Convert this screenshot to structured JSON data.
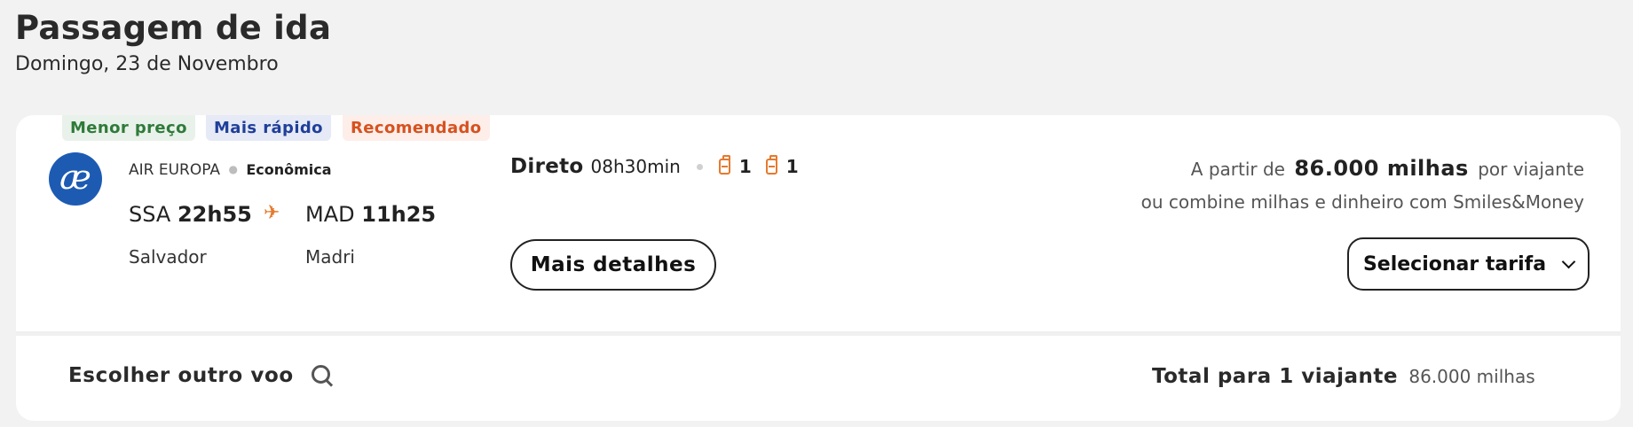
{
  "header": {
    "title": "Passagem de ida",
    "subtitle": "Domingo, 23 de Novembro"
  },
  "badges": {
    "cheapest": "Menor preço",
    "fastest": "Mais rápido",
    "recommended": "Recomendado"
  },
  "flight": {
    "airline_logo_text": "æ",
    "airline": "AIR EUROPA",
    "cabin": "Econômica",
    "origin_code": "SSA",
    "origin_time": "22h55",
    "origin_city": "Salvador",
    "destination_code": "MAD",
    "destination_time": "11h25",
    "destination_city": "Madri",
    "stops": "Direto",
    "duration": "08h30min",
    "carry_on_count": "1",
    "checked_bag_count": "1",
    "details_button": "Mais detalhes"
  },
  "price": {
    "prefix": "A partir de",
    "amount": "86.000 milhas",
    "suffix": "por viajante",
    "alt_text": "ou combine milhas e dinheiro com Smiles&Money",
    "select_button": "Selecionar tarifa"
  },
  "footer": {
    "other_flight": "Escolher outro voo",
    "total_label": "Total para 1 viajante",
    "total_value": "86.000 milhas"
  },
  "colors": {
    "accent_orange": "#e57a2e",
    "airline_blue": "#1d5bb3",
    "badge_green": "#2f7a3a",
    "badge_blue": "#1f3f99",
    "badge_orange": "#d6521f"
  },
  "icons": {
    "airplane": "plane-icon",
    "carry_on": "backpack-icon",
    "checked_bag": "suitcase-icon",
    "dropdown": "chevron-down-icon",
    "search": "search-icon"
  }
}
